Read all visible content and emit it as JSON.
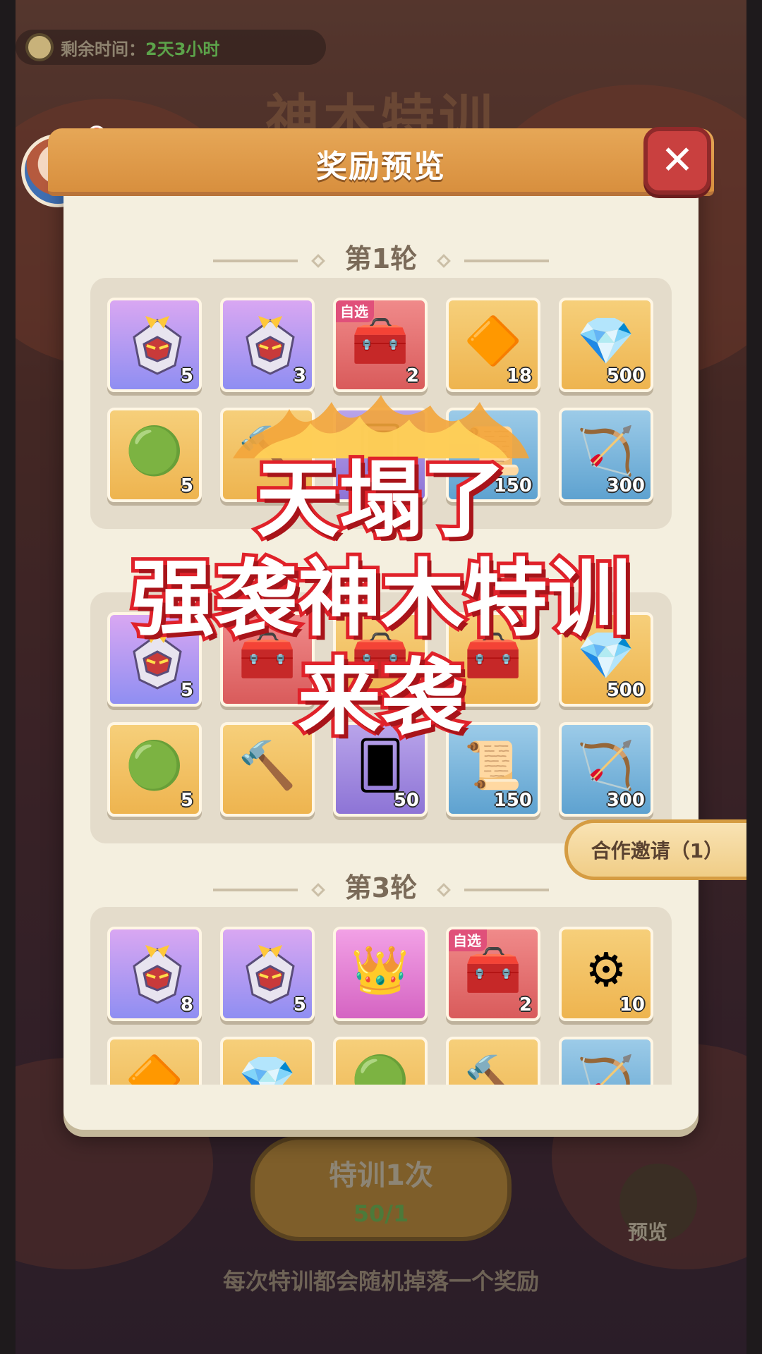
{
  "timer": {
    "label": "剩余时间：",
    "value": "2天3小时"
  },
  "background": {
    "title": "神木特训",
    "train_button": {
      "label": "特训1次",
      "cost": "50/1"
    },
    "preview_label": "预览",
    "tip": "每次特训都会随机掉落一个奖励"
  },
  "modal": {
    "title": "奖励预览",
    "close_label": "✕",
    "coop_invite": "合作邀请（1）",
    "rounds": [
      {
        "title": "第1轮",
        "items": [
          {
            "icon": "mech-hero-icon",
            "bg": "purple",
            "count": "5",
            "tag": ""
          },
          {
            "icon": "mech-hero-icon",
            "bg": "purple",
            "count": "3",
            "tag": ""
          },
          {
            "icon": "treasure-chest-icon",
            "bg": "red",
            "count": "2",
            "tag": "自选"
          },
          {
            "icon": "amber-ore-icon",
            "bg": "gold",
            "count": "18",
            "tag": ""
          },
          {
            "icon": "diamond-icon",
            "bg": "gold",
            "count": "500",
            "tag": ""
          },
          {
            "icon": "green-orb-icon",
            "bg": "gold",
            "count": "5",
            "tag": ""
          },
          {
            "icon": "hammer-icon",
            "bg": "gold",
            "count": "",
            "tag": ""
          },
          {
            "icon": "card-icon",
            "bg": "violet",
            "count": "",
            "tag": ""
          },
          {
            "icon": "scroll-icon",
            "bg": "blue",
            "count": "150",
            "tag": ""
          },
          {
            "icon": "bow-coin-icon",
            "bg": "blue",
            "count": "300",
            "tag": ""
          }
        ]
      },
      {
        "title": "第2轮",
        "items": [
          {
            "icon": "mech-hero-icon",
            "bg": "purple",
            "count": "5",
            "tag": ""
          },
          {
            "icon": "treasure-chest-icon",
            "bg": "red",
            "count": "",
            "tag": ""
          },
          {
            "icon": "treasure-chest-icon",
            "bg": "gold",
            "count": "",
            "tag": ""
          },
          {
            "icon": "treasure-chest-icon",
            "bg": "gold",
            "count": "",
            "tag": ""
          },
          {
            "icon": "diamond-icon",
            "bg": "gold",
            "count": "500",
            "tag": ""
          },
          {
            "icon": "green-orb-icon",
            "bg": "gold",
            "count": "5",
            "tag": ""
          },
          {
            "icon": "hammer-icon",
            "bg": "gold",
            "count": "",
            "tag": ""
          },
          {
            "icon": "card-icon",
            "bg": "violet",
            "count": "50",
            "tag": ""
          },
          {
            "icon": "scroll-icon",
            "bg": "blue",
            "count": "150",
            "tag": ""
          },
          {
            "icon": "bow-coin-icon",
            "bg": "blue",
            "count": "300",
            "tag": ""
          }
        ]
      },
      {
        "title": "第3轮",
        "items": [
          {
            "icon": "mech-hero-icon",
            "bg": "purple",
            "count": "8",
            "tag": ""
          },
          {
            "icon": "mech-hero-icon",
            "bg": "purple",
            "count": "5",
            "tag": ""
          },
          {
            "icon": "royal-chest-icon",
            "bg": "pink",
            "count": "",
            "tag": ""
          },
          {
            "icon": "treasure-chest-icon",
            "bg": "red",
            "count": "2",
            "tag": "自选"
          },
          {
            "icon": "gear-disc-icon",
            "bg": "gold",
            "count": "10",
            "tag": ""
          },
          {
            "icon": "amber-ore-icon",
            "bg": "gold",
            "count": "",
            "tag": ""
          },
          {
            "icon": "diamond-icon",
            "bg": "gold",
            "count": "",
            "tag": ""
          },
          {
            "icon": "green-orb-icon",
            "bg": "gold",
            "count": "",
            "tag": ""
          },
          {
            "icon": "hammer-icon",
            "bg": "gold",
            "count": "",
            "tag": ""
          },
          {
            "icon": "bow-coin-icon",
            "bg": "blue",
            "count": "",
            "tag": ""
          }
        ]
      }
    ]
  },
  "overlay": {
    "line1": "天塌了",
    "line2": "强袭神木特训",
    "line3": "来袭"
  },
  "colors": {
    "header": "#e6a757",
    "close": "#c9403f",
    "headline_stroke": "#e0222a",
    "panel": "#f4efdf"
  }
}
